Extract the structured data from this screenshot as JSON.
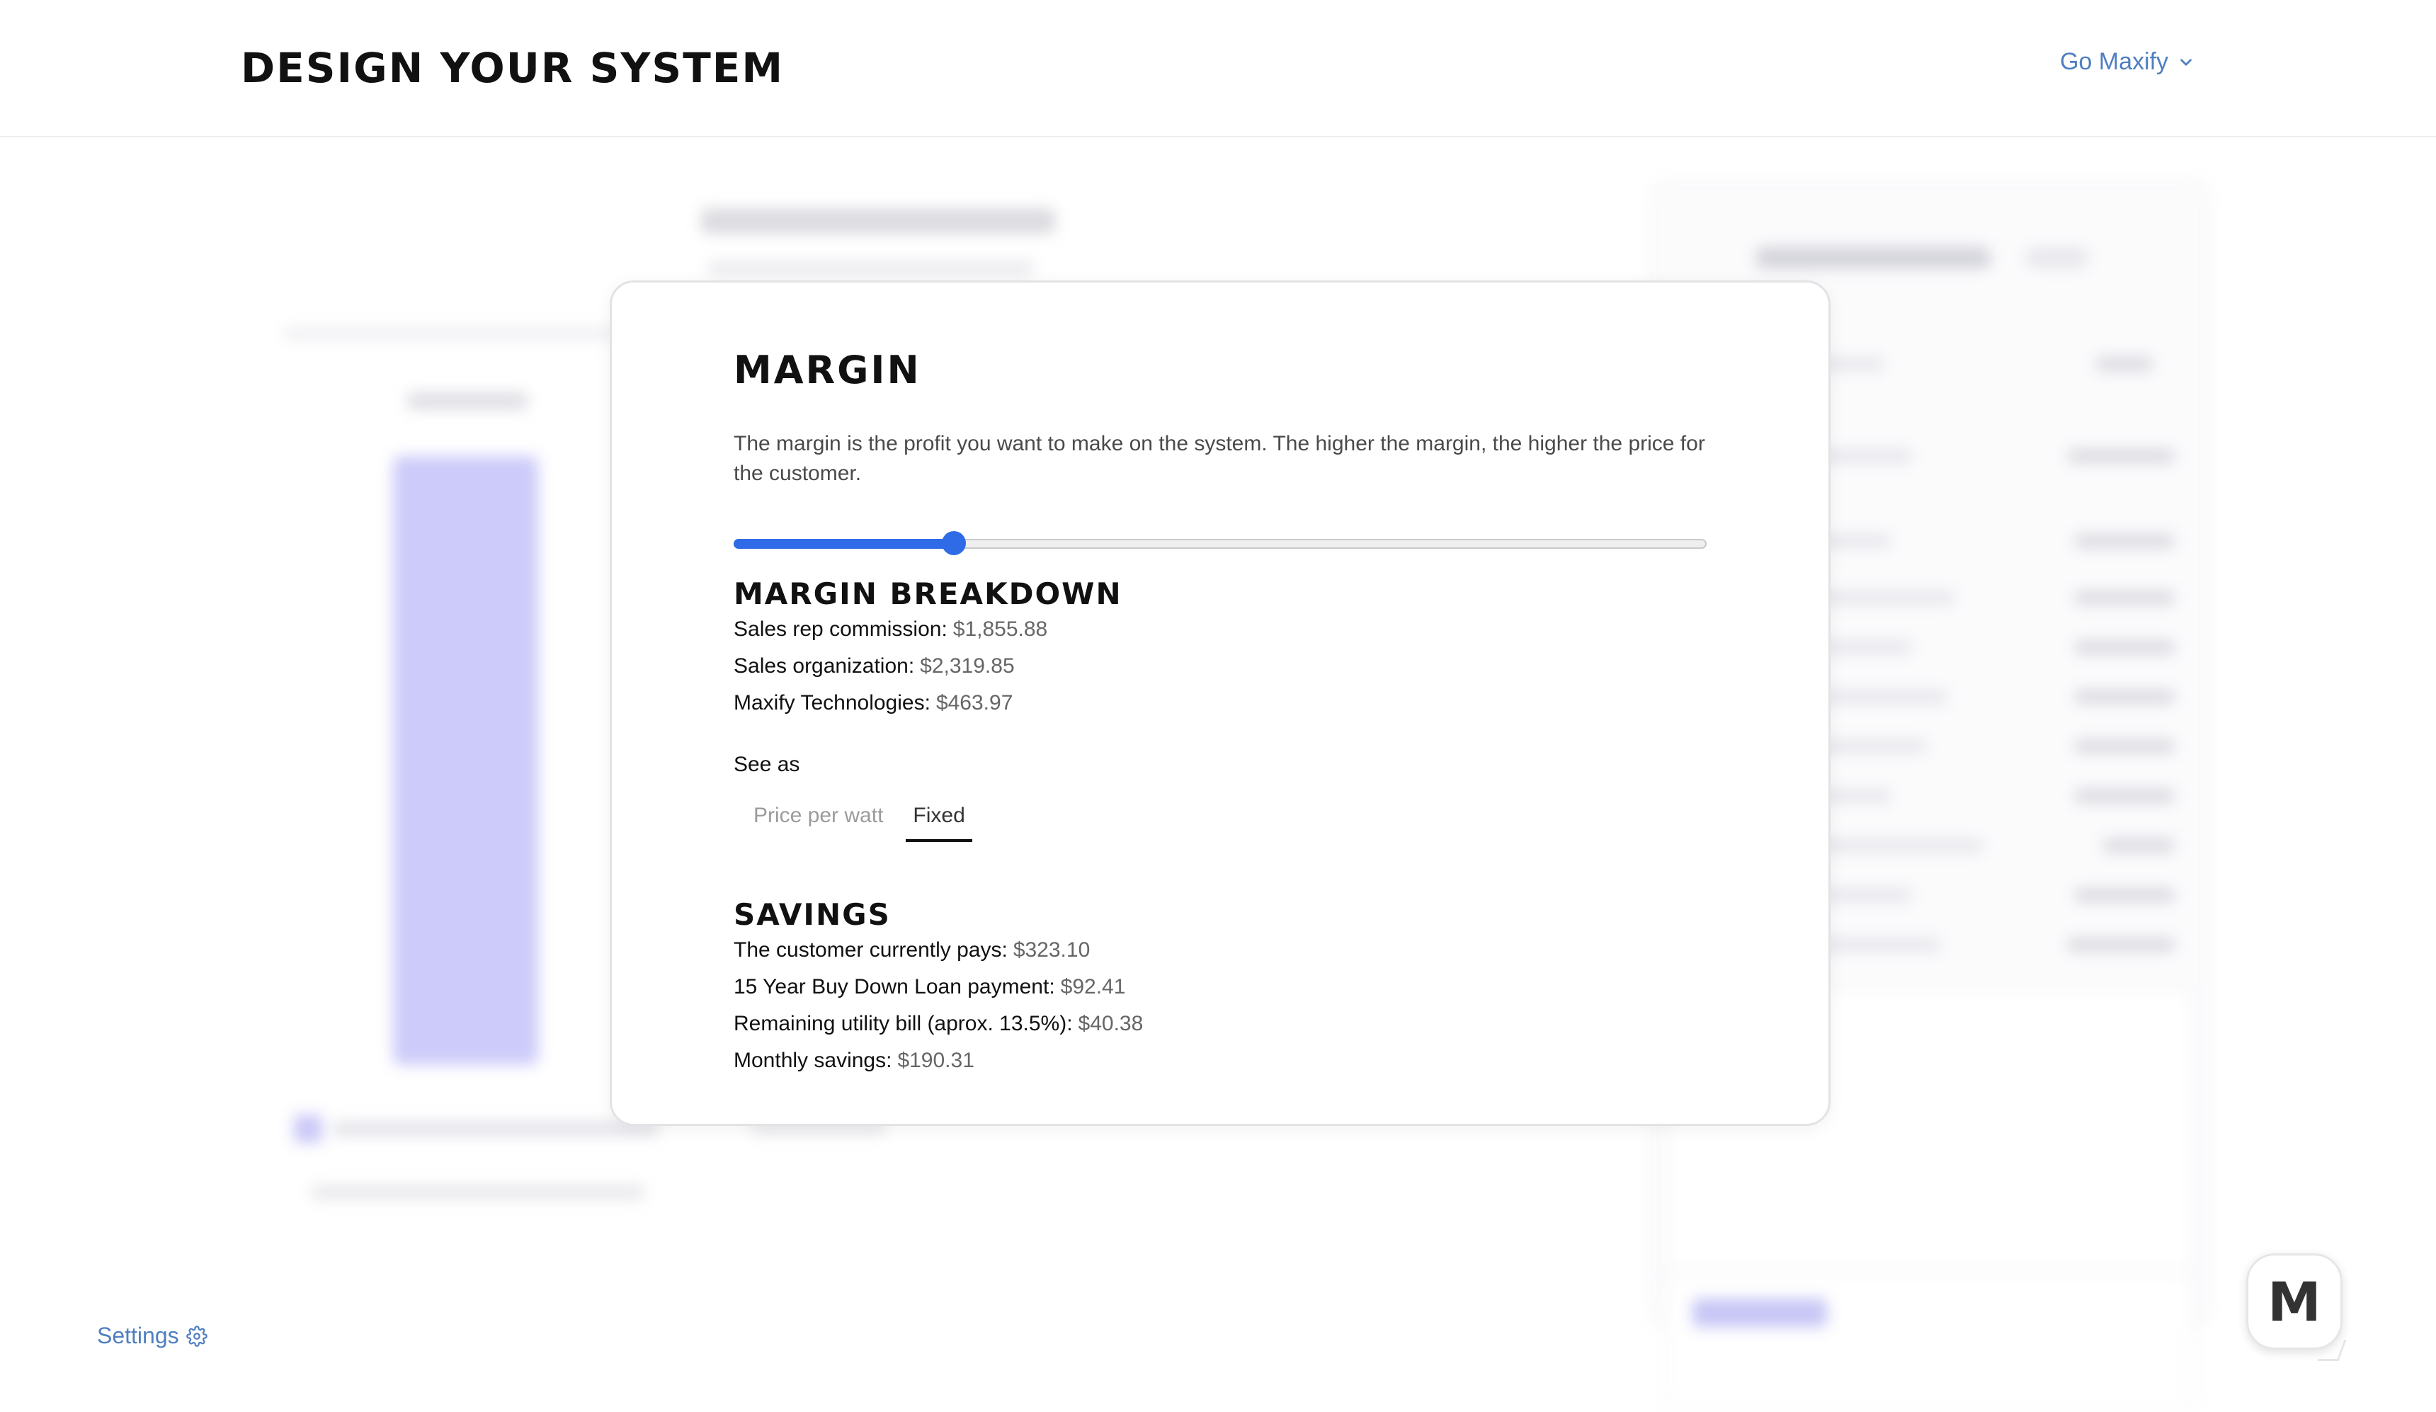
{
  "header": {
    "title": "DESIGN YOUR SYSTEM",
    "user_menu_label": "Go Maxify"
  },
  "modal": {
    "title": "MARGIN",
    "description": "The margin is the profit you want to make on the system. The higher the margin, the higher the price for the customer.",
    "slider": {
      "value_fraction": 0.226,
      "fill_color": "#2f6be6"
    },
    "breakdown": {
      "title": "MARGIN BREAKDOWN",
      "rows": [
        {
          "label": "Sales rep commission:",
          "value": "$1,855.88"
        },
        {
          "label": "Sales organization:",
          "value": "$2,319.85"
        },
        {
          "label": "Maxify Technologies:",
          "value": "$463.97"
        }
      ]
    },
    "see_as": {
      "label": "See as",
      "options": [
        "Price per watt",
        "Fixed"
      ],
      "selected": "Fixed"
    },
    "savings": {
      "title": "SAVINGS",
      "rows": [
        {
          "label": "The customer currently pays:",
          "value": "$323.10"
        },
        {
          "label": "15 Year Buy Down Loan payment:",
          "value": "$92.41"
        },
        {
          "label": "Remaining utility bill (aprox. 13.5%):",
          "value": "$40.38"
        },
        {
          "label": "Monthly savings:",
          "value": "$190.31"
        }
      ]
    }
  },
  "footer": {
    "settings_label": "Settings"
  },
  "chat": {
    "letter": "M"
  },
  "icons": {
    "user_menu": "chevron-down-icon",
    "settings": "gear-icon"
  },
  "colors": {
    "accent_link": "#4f7fc0",
    "slider_blue": "#2f6be6",
    "bg_bar": "#bcbaf8"
  }
}
